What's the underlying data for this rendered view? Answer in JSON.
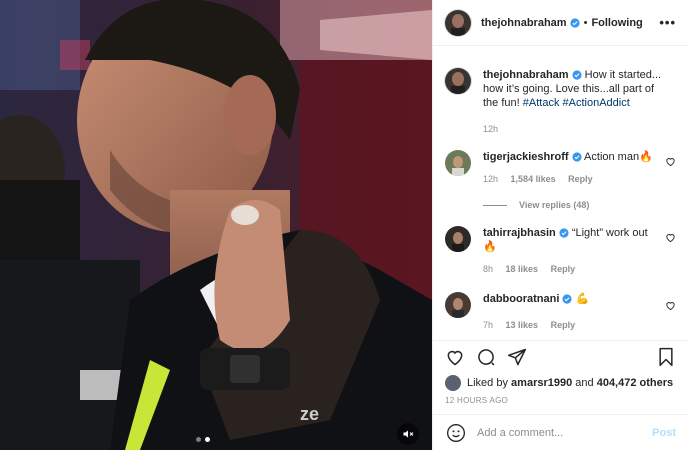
{
  "post": {
    "author": "thejohnabraham",
    "follow_status": "Following",
    "more_label": "•••",
    "separator": "•",
    "caption": {
      "text": "How it started... how it’s going. Love this...all part of the fun! ",
      "hashtags": [
        "#Attack",
        "#ActionAddict"
      ],
      "time": "12h"
    },
    "comments": [
      {
        "user": "tigerjackieshroff",
        "verified": true,
        "text": "Action man",
        "emoji": "🔥",
        "time": "12h",
        "likes": "1,584 likes",
        "reply": "Reply",
        "view_replies": "View replies (48)"
      },
      {
        "user": "tahirrajbhasin",
        "verified": true,
        "text": "“Light” work out ",
        "emoji": "🔥",
        "time": "8h",
        "likes": "18 likes",
        "reply": "Reply"
      },
      {
        "user": "dabbooratnani",
        "verified": true,
        "text": "",
        "emoji": "💪",
        "time": "7h",
        "likes": "13 likes",
        "reply": "Reply"
      }
    ],
    "liked_by": {
      "prefix": "Liked by ",
      "user": "amarsr1990",
      "middle": " and ",
      "count": "404,472 others"
    },
    "timestamp": "12 HOURS AGO",
    "comment_box": {
      "placeholder": "Add a comment...",
      "post_label": "Post"
    },
    "media": {
      "carousel_total": 2,
      "carousel_active": 1
    }
  },
  "colors": {
    "link": "#00376b",
    "verified": "#3897f0",
    "muted": "#8e8e8e",
    "post_disabled": "#b2dffc"
  }
}
